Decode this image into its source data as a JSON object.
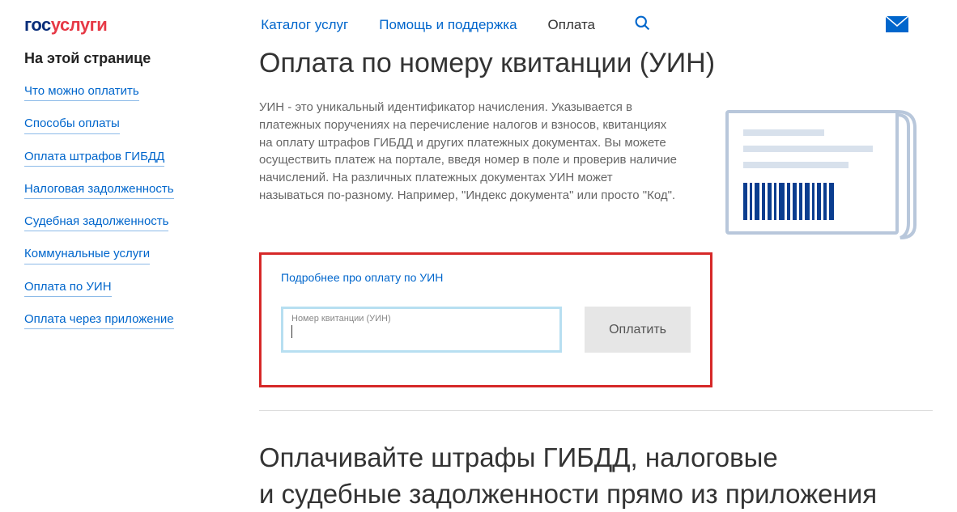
{
  "logo": {
    "part1": "гос",
    "part2": "услуги"
  },
  "nav": {
    "catalog": "Каталог услуг",
    "help": "Помощь и поддержка",
    "payment": "Оплата"
  },
  "sidebar": {
    "title": "На этой странице",
    "items": [
      "Что можно оплатить",
      "Способы оплаты",
      "Оплата штрафов ГИБДД",
      "Налоговая задолженность",
      "Судебная задолженность",
      "Коммунальные услуги",
      "Оплата по УИН",
      "Оплата через приложение"
    ]
  },
  "main": {
    "title": "Оплата по номеру квитанции (УИН)",
    "description": "УИН - это уникальный идентификатор начисления. Указывается в платежных поручениях на перечисление налогов и взносов, квитанциях на оплату штрафов ГИБДД и других платежных документах. Вы можете осуществить платеж на портале, введя номер в поле и проверив наличие начислений. На различных платежных документах УИН может называться по-разному. Например, \"Индекс документа\" или просто \"Код\".",
    "learn_more": "Подробнее про оплату по УИН",
    "input_label": "Номер квитанции (УИН)",
    "pay_button": "Оплатить",
    "second_heading_l1": "Оплачивайте штрафы ГИБДД, налоговые",
    "second_heading_l2": "и судебные задолженности прямо из приложения"
  }
}
